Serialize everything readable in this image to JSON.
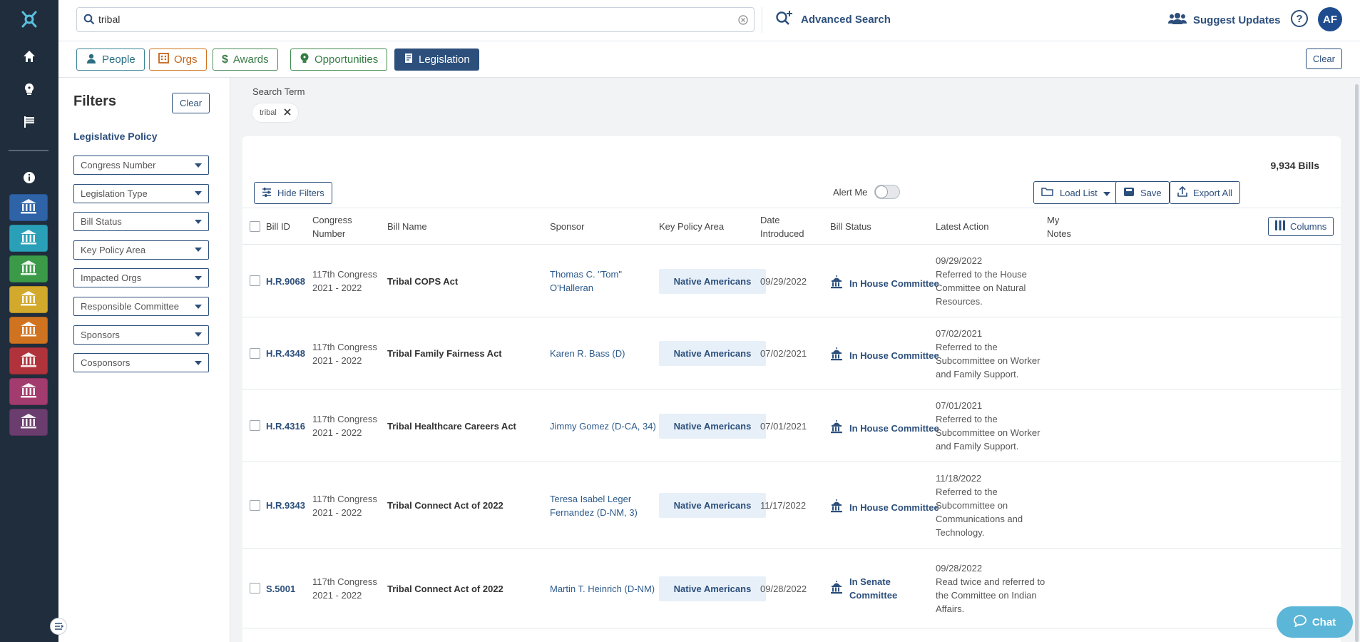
{
  "search": {
    "value": "tribal",
    "advanced_label": "Advanced Search"
  },
  "header": {
    "suggest_label": "Suggest Updates",
    "help_label": "?",
    "avatar_initials": "AF"
  },
  "type_tabs": [
    {
      "label": "People",
      "color": "#2b6f80"
    },
    {
      "label": "Orgs",
      "color": "#c4641a"
    },
    {
      "label": "Awards",
      "color": "#3b7a48"
    },
    {
      "label": "Opportunities",
      "color": "#357d43"
    },
    {
      "label": "Legislation",
      "color": "#2c4f7c",
      "active": true
    }
  ],
  "top_clear_label": "Clear",
  "rail": {
    "nav_icons": [
      "home-icon",
      "lightbulb-icon",
      "flag-icon",
      "info-icon"
    ],
    "tiles": [
      {
        "icon": "capitol-icon",
        "color": "#2e63a8"
      },
      {
        "icon": "institution-icon",
        "color": "#2aa0b8"
      },
      {
        "icon": "government-building-icon",
        "color": "#3a9a48"
      },
      {
        "icon": "money-building-icon",
        "color": "#d2a92a"
      },
      {
        "icon": "justice-scale-icon",
        "color": "#d07320"
      },
      {
        "icon": "city-building-icon",
        "color": "#b0333c"
      },
      {
        "icon": "hand-globe-icon",
        "color": "#a23b6e"
      },
      {
        "icon": "gavel-icon",
        "color": "#6a3d6e"
      }
    ]
  },
  "filters": {
    "title": "Filters",
    "clear_label": "Clear",
    "section": "Legislative Policy",
    "dropdowns": [
      "Congress Number",
      "Legislation Type",
      "Bill Status",
      "Key Policy Area",
      "Impacted Orgs",
      "Responsible Committee",
      "Sponsors",
      "Cosponsors"
    ]
  },
  "search_term": {
    "label": "Search Term",
    "chip": "tribal"
  },
  "results": {
    "count": "9,934 Bills",
    "hide_filters": "Hide Filters",
    "alert_me": "Alert Me",
    "load_list": "Load List",
    "save": "Save",
    "export_all": "Export All",
    "columns_btn": "Columns"
  },
  "table": {
    "headers": {
      "bill_id": "Bill ID",
      "congress_1": "Congress",
      "congress_2": "Number",
      "bill_name": "Bill Name",
      "sponsor": "Sponsor",
      "policy": "Key Policy Area",
      "date_1": "Date",
      "date_2": "Introduced",
      "status": "Bill Status",
      "action": "Latest Action",
      "notes_1": "My",
      "notes_2": "Notes"
    },
    "rows": [
      {
        "id": "H.R.9068",
        "congress": "117th Congress",
        "years": "2021 - 2022",
        "name": "Tribal COPS Act",
        "sponsor_1": "Thomas C. \"Tom\"",
        "sponsor_2": "O'Halleran",
        "policy": "Native Americans",
        "date": "09/29/2022",
        "status_1": "In House Committee",
        "status_2": "",
        "action_date": "09/29/2022",
        "action_1": "Referred to the House",
        "action_2": "Committee on Natural",
        "action_3": "Resources.",
        "action_4": ""
      },
      {
        "id": "H.R.4348",
        "congress": "117th Congress",
        "years": "2021 - 2022",
        "name": "Tribal Family Fairness Act",
        "sponsor_1": "Karen R. Bass (D)",
        "sponsor_2": "",
        "policy": "Native Americans",
        "date": "07/02/2021",
        "status_1": "In House Committee",
        "status_2": "",
        "action_date": "07/02/2021",
        "action_1": "Referred to the",
        "action_2": "Subcommittee on Worker",
        "action_3": "and Family Support.",
        "action_4": ""
      },
      {
        "id": "H.R.4316",
        "congress": "117th Congress",
        "years": "2021 - 2022",
        "name": "Tribal Healthcare Careers Act",
        "sponsor_1": "Jimmy Gomez (D-CA, 34)",
        "sponsor_2": "",
        "policy": "Native Americans",
        "date": "07/01/2021",
        "status_1": "In House Committee",
        "status_2": "",
        "action_date": "07/01/2021",
        "action_1": "Referred to the",
        "action_2": "Subcommittee on Worker",
        "action_3": "and Family Support.",
        "action_4": ""
      },
      {
        "id": "H.R.9343",
        "congress": "117th Congress",
        "years": "2021 - 2022",
        "name": "Tribal Connect Act of 2022",
        "sponsor_1": "Teresa Isabel Leger",
        "sponsor_2": "Fernandez (D-NM, 3)",
        "policy": "Native Americans",
        "date": "11/17/2022",
        "status_1": "In House Committee",
        "status_2": "",
        "action_date": "11/18/2022",
        "action_1": "Referred to the",
        "action_2": "Subcommittee on",
        "action_3": "Communications and",
        "action_4": "Technology."
      },
      {
        "id": "S.5001",
        "congress": "117th Congress",
        "years": "2021 - 2022",
        "name": "Tribal Connect Act of 2022",
        "sponsor_1": "Martin T. Heinrich (D-NM)",
        "sponsor_2": "",
        "policy": "Native Americans",
        "date": "09/28/2022",
        "status_1": "In Senate",
        "status_2": "Committee",
        "action_date": "09/28/2022",
        "action_1": "Read twice and referred to",
        "action_2": "the Committee on Indian",
        "action_3": "Affairs.",
        "action_4": ""
      }
    ]
  },
  "chat_label": "Chat"
}
